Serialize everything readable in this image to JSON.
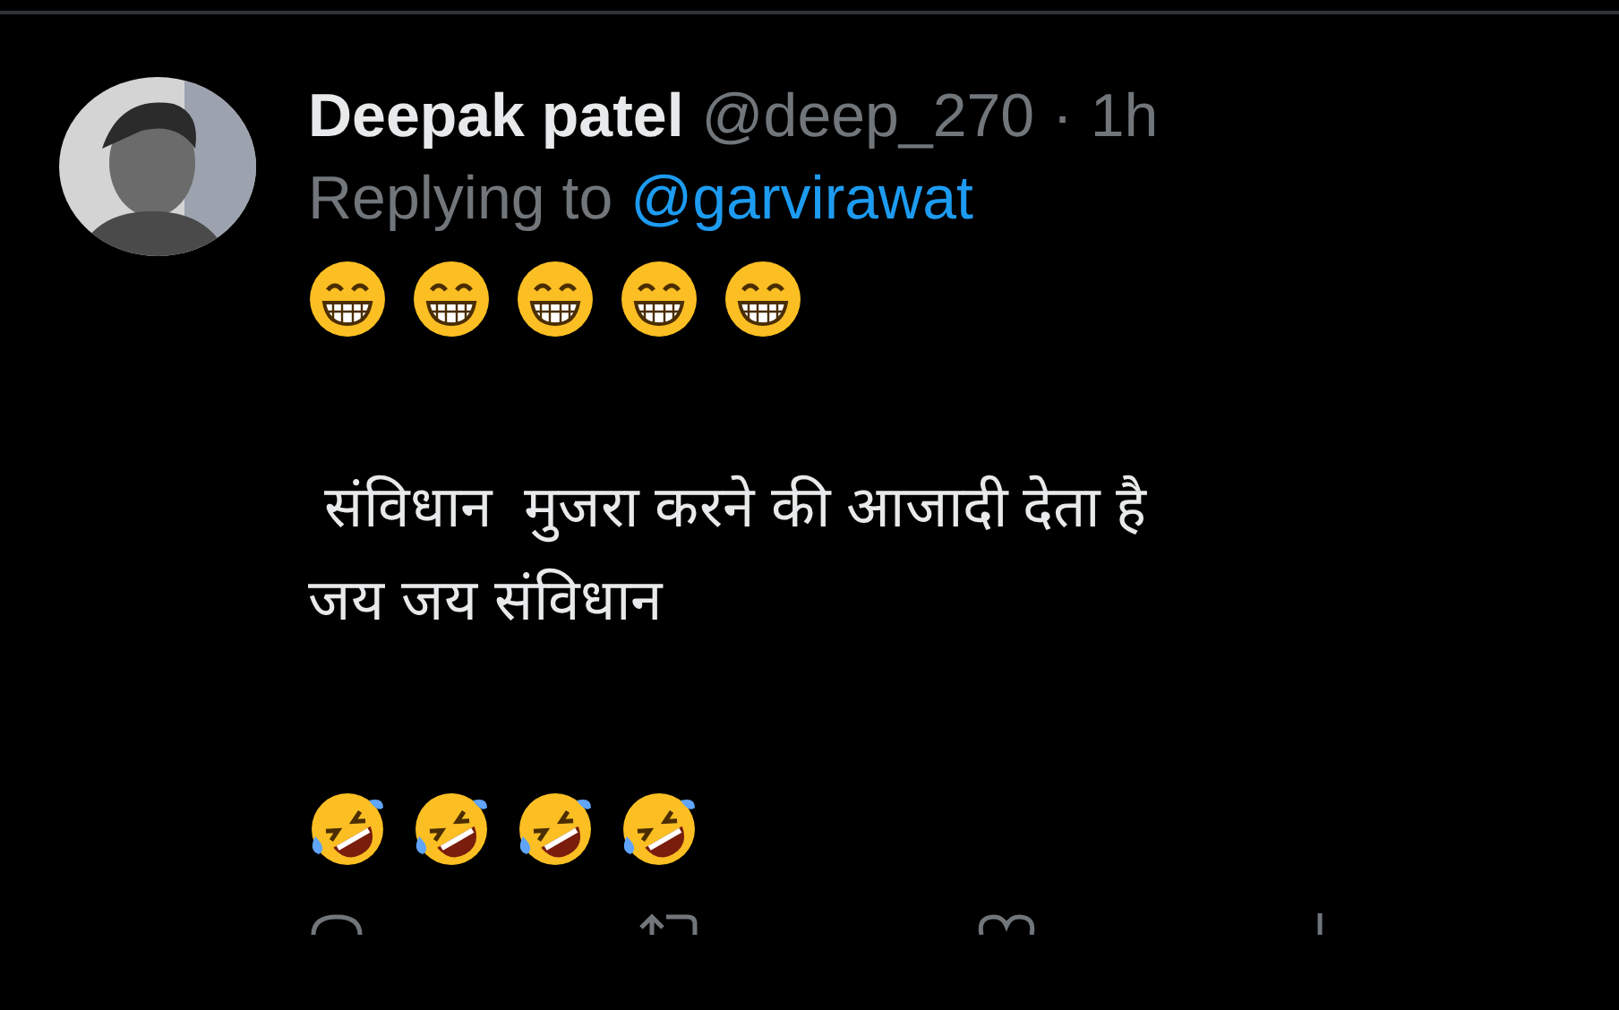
{
  "author": {
    "name": "Deepak patel",
    "handle": "@deep_270",
    "separator": "·",
    "time": "1h"
  },
  "reply": {
    "prefix": "Replying to",
    "mention": "@garvirawat"
  },
  "body": {
    "top_emojis": [
      {
        "kind": "grin"
      },
      {
        "kind": "grin"
      },
      {
        "kind": "grin"
      },
      {
        "kind": "grin"
      },
      {
        "kind": "grin"
      }
    ],
    "lines": [
      " संविधान  मुजरा करने की आजादी देता है",
      "जय जय संविधान"
    ],
    "bottom_emojis": [
      {
        "kind": "rofl"
      },
      {
        "kind": "rofl"
      },
      {
        "kind": "rofl"
      },
      {
        "kind": "rofl"
      }
    ]
  },
  "actions": [
    {
      "kind": "reply"
    },
    {
      "kind": "repost"
    },
    {
      "kind": "like"
    },
    {
      "kind": "views"
    }
  ]
}
